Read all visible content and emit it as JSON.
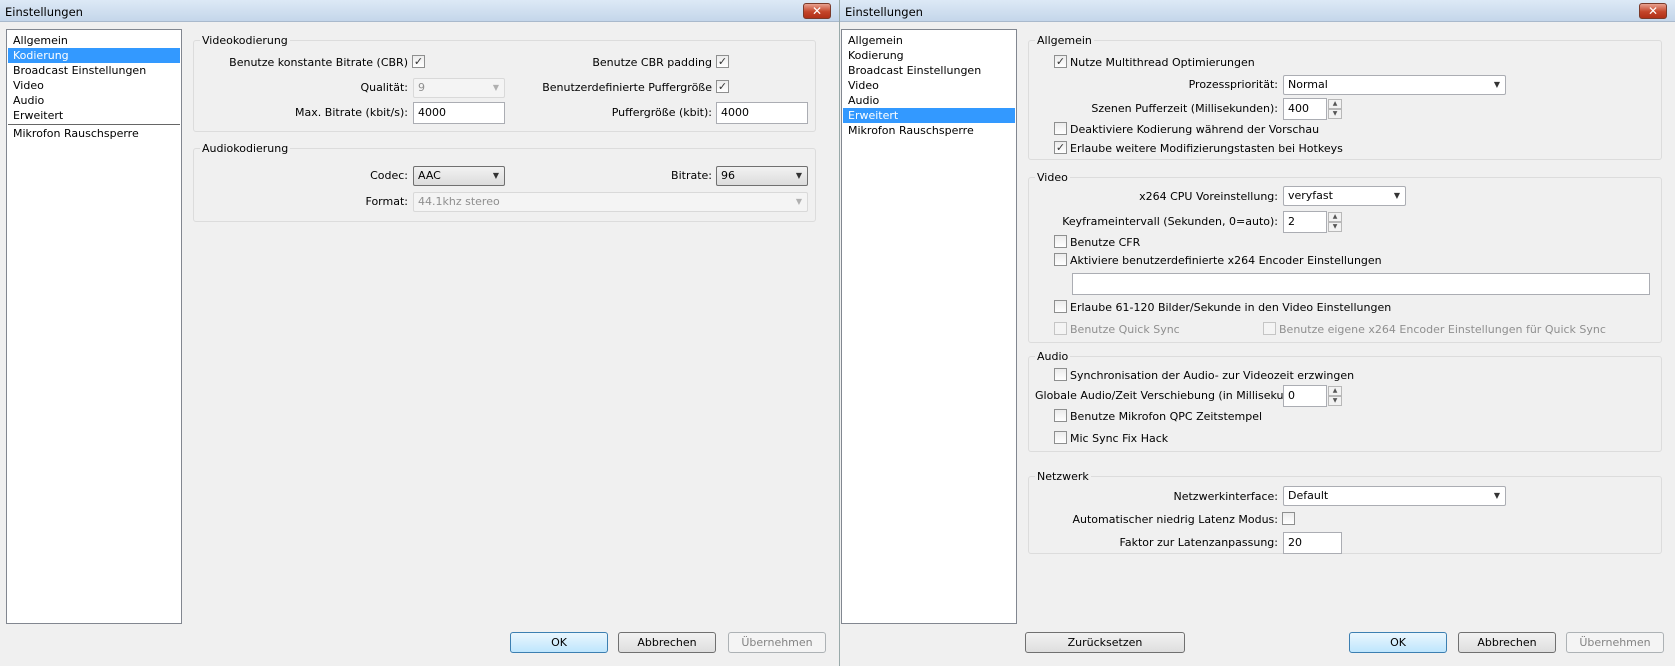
{
  "left": {
    "title": "Einstellungen",
    "close": "✕",
    "sidebar": [
      "Allgemein",
      "Kodierung",
      "Broadcast Einstellungen",
      "Video",
      "Audio",
      "Erweitert",
      "Mikrofon Rauschsperre"
    ],
    "selected": "Kodierung",
    "video": {
      "title": "Videokodierung",
      "cbr_label": "Benutze konstante Bitrate (CBR)",
      "cbr_checked": true,
      "cbr_padding_label": "Benutze CBR padding",
      "cbr_padding_checked": true,
      "quality_label": "Qualität:",
      "quality_value": "9",
      "custom_buffer_label": "Benutzerdefinierte Puffergröße",
      "custom_buffer_checked": true,
      "max_bitrate_label": "Max. Bitrate (kbit/s):",
      "max_bitrate_value": "4000",
      "buffer_size_label": "Puffergröße (kbit):",
      "buffer_size_value": "4000"
    },
    "audio": {
      "title": "Audiokodierung",
      "codec_label": "Codec:",
      "codec_value": "AAC",
      "bitrate_label": "Bitrate:",
      "bitrate_value": "96",
      "format_label": "Format:",
      "format_value": "44.1khz stereo"
    },
    "buttons": {
      "ok": "OK",
      "cancel": "Abbrechen",
      "apply": "Übernehmen"
    }
  },
  "right": {
    "title": "Einstellungen",
    "close": "✕",
    "sidebar": [
      "Allgemein",
      "Kodierung",
      "Broadcast Einstellungen",
      "Video",
      "Audio",
      "Erweitert",
      "Mikrofon Rauschsperre"
    ],
    "selected": "Erweitert",
    "general": {
      "title": "Allgemein",
      "multithread_label": "Nutze Multithread Optimierungen",
      "multithread_checked": true,
      "priority_label": "Prozesspriorität:",
      "priority_value": "Normal",
      "scene_buffer_label": "Szenen Pufferzeit (Millisekunden):",
      "scene_buffer_value": "400",
      "disable_preview_label": "Deaktiviere Kodierung während der Vorschau",
      "disable_preview_checked": false,
      "hotkeys_label": "Erlaube weitere Modifizierungstasten bei Hotkeys",
      "hotkeys_checked": true
    },
    "video": {
      "title": "Video",
      "preset_label": "x264 CPU Voreinstellung:",
      "preset_value": "veryfast",
      "keyframe_label": "Keyframeintervall (Sekunden, 0=auto):",
      "keyframe_value": "2",
      "cfr_label": "Benutze CFR",
      "cfr_checked": false,
      "custom_x264_label": "Aktiviere benutzerdefinierte x264 Encoder Einstellungen",
      "custom_x264_checked": false,
      "custom_x264_value": "",
      "fps_label": "Erlaube 61-120 Bilder/Sekunde in den Video Einstellungen",
      "fps_checked": false,
      "quicksync_label": "Benutze Quick Sync",
      "quicksync_checked": false,
      "quicksync_x264_label": "Benutze eigene x264 Encoder Einstellungen für Quick Sync",
      "quicksync_x264_checked": false
    },
    "audio": {
      "title": "Audio",
      "sync_label": "Synchronisation der Audio- zur Videozeit erzwingen",
      "sync_checked": false,
      "offset_label": "Globale Audio/Zeit Verschiebung (in Millisekunden):",
      "offset_value": "0",
      "qpc_label": "Benutze Mikrofon QPC Zeitstempel",
      "qpc_checked": false,
      "micfix_label": "Mic Sync Fix Hack",
      "micfix_checked": false
    },
    "network": {
      "title": "Netzwerk",
      "interface_label": "Netzwerkinterface:",
      "interface_value": "Default",
      "low_latency_label": "Automatischer niedrig Latenz Modus:",
      "low_latency_checked": false,
      "latency_factor_label": "Faktor zur Latenzanpassung:",
      "latency_factor_value": "20"
    },
    "buttons": {
      "reset": "Zurücksetzen",
      "ok": "OK",
      "cancel": "Abbrechen",
      "apply": "Übernehmen"
    }
  }
}
